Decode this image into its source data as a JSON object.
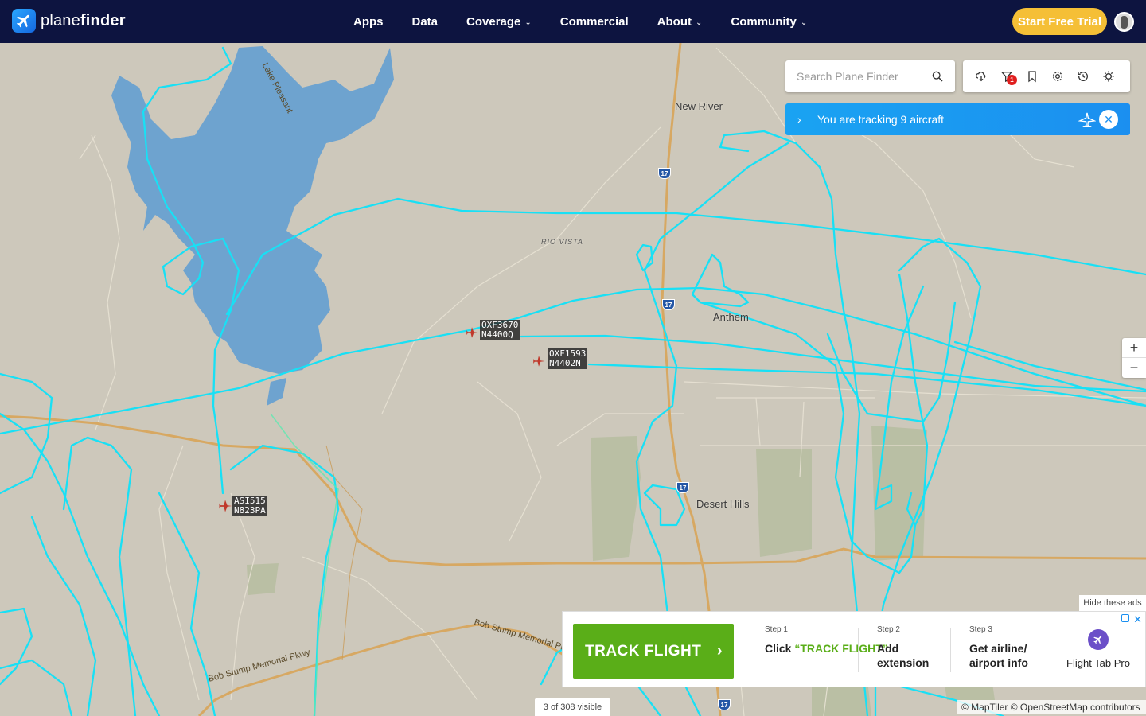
{
  "header": {
    "logo_text_plane": "plane",
    "logo_text_finder": "finder",
    "nav": [
      {
        "label": "Apps",
        "has_dropdown": false
      },
      {
        "label": "Data",
        "has_dropdown": false
      },
      {
        "label": "Coverage",
        "has_dropdown": true
      },
      {
        "label": "Commercial",
        "has_dropdown": false
      },
      {
        "label": "About",
        "has_dropdown": true
      },
      {
        "label": "Community",
        "has_dropdown": true
      }
    ],
    "cta_label": "Start Free Trial"
  },
  "search": {
    "placeholder": "Search Plane Finder"
  },
  "toolbar": {
    "icons": [
      "weather-icon",
      "filter-icon",
      "bookmark-icon",
      "settings-icon",
      "history-icon",
      "night-mode-icon"
    ],
    "filter_badge": "1"
  },
  "tracking": {
    "text": "You are tracking 9 aircraft"
  },
  "map": {
    "places": [
      "New River",
      "Anthem",
      "Desert Hills",
      "RIO VISTA",
      "Lake Pleasant"
    ],
    "roads": [
      "Bob Stump Memorial Pkwy",
      "Bob Stump Memorial Pkwy"
    ],
    "highway_shield": "17",
    "aircraft": [
      {
        "callsign": "OXF3670",
        "registration": "N4400Q"
      },
      {
        "callsign": "OXF1593",
        "registration": "N4402N"
      },
      {
        "callsign": "ASI515",
        "registration": "N823PA"
      }
    ],
    "visible_count": "3 of 308 visible",
    "attribution": "© MapTiler © OpenStreetMap contributors",
    "zoom_in": "+",
    "zoom_out": "−"
  },
  "ad": {
    "hide_label": "Hide these ads",
    "button_label": "TRACK FLIGHT",
    "steps": [
      {
        "label": "Step 1",
        "text_prefix": "Click ",
        "text_highlight": "“TRACK FLIGHT”"
      },
      {
        "label": "Step 2",
        "text": "Add extension"
      },
      {
        "label": "Step 3",
        "text": "Get airline/ airport info"
      }
    ],
    "extension_name": "Flight Tab Pro"
  },
  "colors": {
    "header_bg": "#0d1440",
    "cta": "#f5bf36",
    "track": "#18e0f5",
    "water": "#6ea3cf",
    "tracking_banner": "#1b8ff0",
    "ad_green": "#5aae18"
  }
}
